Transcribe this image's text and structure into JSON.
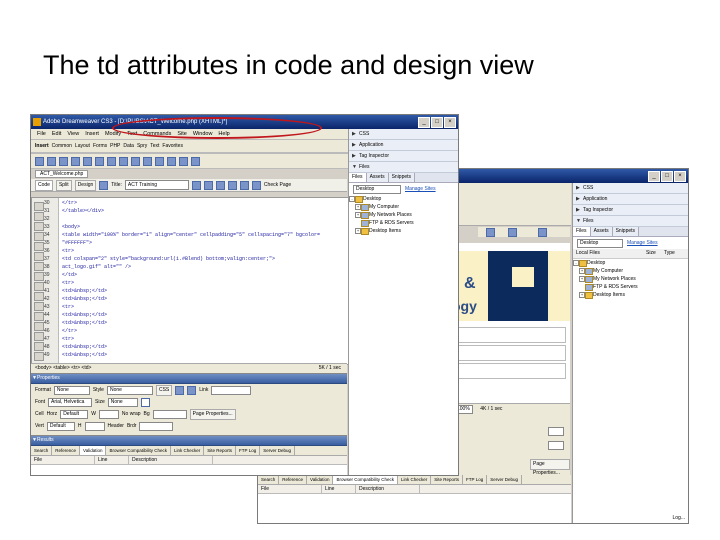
{
  "slide": {
    "title": "The td attributes in code and design view"
  },
  "front_window": {
    "title": "Adobe Dreamweaver CS3 - [D:\\PUBS\\ACT_Welcome.php (XHTML)*]",
    "window_buttons": [
      "_",
      "□",
      "×"
    ],
    "menu": [
      "File",
      "Edit",
      "View",
      "Insert",
      "Modify",
      "Text",
      "Commands",
      "Site",
      "Window",
      "Help"
    ],
    "insert_toolbar": [
      "Insert",
      "Common",
      "Layout",
      "Forms",
      "PHP",
      "Data",
      "Spry",
      "Text",
      "Favorites"
    ],
    "doc_tab": "ACT_Welcome.php",
    "view_buttons": [
      "Code",
      "Split",
      "Design"
    ],
    "title_label": "Title:",
    "title_value": "ACT Training",
    "check_page": "Check Page",
    "code_lines": [
      {
        "num": "30",
        "text": "</tr>"
      },
      {
        "num": "31",
        "text": "</table></div>"
      },
      {
        "num": "32",
        "text": ""
      },
      {
        "num": "33",
        "text": "<body>"
      },
      {
        "num": "34",
        "text": "<table width=\"100%\" border=\"1\" align=\"center\" cellpadding=\"5\" cellspacing=\"7\" bgcolor="
      },
      {
        "num": "35",
        "text": "\"#FFFFFF\">"
      },
      {
        "num": "36",
        "text": "<tr>"
      },
      {
        "num": "37",
        "text": "<td colspan=\"2\" style=\"background:url(i.#Blend) bottom;valign:center;\">"
      },
      {
        "num": "38",
        "text": "act_logo.gif\" alt=\"\" />"
      },
      {
        "num": "39",
        "text": "</td>"
      },
      {
        "num": "40",
        "text": "<tr>"
      },
      {
        "num": "41",
        "text": "<td>&nbsp;</td>"
      },
      {
        "num": "42",
        "text": "<td>&nbsp;</td>"
      },
      {
        "num": "43",
        "text": "<tr>"
      },
      {
        "num": "44",
        "text": "<td>&nbsp;</td>"
      },
      {
        "num": "45",
        "text": "<td>&nbsp;</td>"
      },
      {
        "num": "46",
        "text": "</tr>"
      },
      {
        "num": "47",
        "text": "<tr>"
      },
      {
        "num": "48",
        "text": "<td>&nbsp;</td>"
      },
      {
        "num": "49",
        "text": "<td>&nbsp;</td>"
      },
      {
        "num": "50",
        "text": "</tr>"
      }
    ],
    "tag_selector": "<body> <table> <tr> <td>",
    "size_readout": "5K / 1 sec",
    "properties": {
      "header": "Properties",
      "format_label": "Format",
      "format_value": "None",
      "style_label": "Style",
      "style_value": "None",
      "css_button": "CSS",
      "link_label": "Link",
      "font_label": "Font",
      "font_value": "Arial, Helvetica",
      "size_label": "Size",
      "size_value": "None",
      "cell_label": "Cell",
      "horz_label": "Horz",
      "horz_value": "Default",
      "vert_label": "Vert",
      "vert_value": "Default",
      "w_label": "W",
      "h_label": "H",
      "nowrap_label": "No wrap",
      "header_label": "Header",
      "bg_label": "Bg",
      "brdr_label": "Brdr",
      "page_properties": "Page Properties..."
    },
    "results": {
      "header": "Results",
      "tabs": [
        "Search",
        "Reference",
        "Validation",
        "Browser Compatibility Check",
        "Link Checker",
        "Site Reports",
        "FTP Log",
        "Server Debug"
      ],
      "columns": [
        "File",
        "Line",
        "Description"
      ]
    },
    "side_panels": [
      "CSS",
      "Application",
      "Tag Inspector",
      "Files"
    ],
    "files": {
      "tabs": [
        "Files",
        "Assets",
        "Snippets"
      ],
      "location": "Desktop",
      "manage_sites": "Manage Sites",
      "items": [
        "Desktop",
        "My Computer",
        "My Network Places",
        "FTP & RDS Servers",
        "Desktop Items"
      ]
    }
  },
  "back_window": {
    "side_panels": [
      "CSS",
      "Application",
      "Tag Inspector",
      "Files"
    ],
    "files_tabs": [
      "Files",
      "Assets",
      "Snippets"
    ],
    "location": "Desktop",
    "manage_sites": "Manage Sites",
    "local_files": "Local Files",
    "size_col": "Size",
    "type_col": "Type",
    "items": [
      "Desktop",
      "My Computer",
      "My Network Places",
      "FTP & RDS Servers",
      "Desktop Items"
    ],
    "logo_text_1": "&",
    "logo_text_2": "ogy",
    "zoom": "100%",
    "size_readout": "4K / 1 sec",
    "results_tabs": [
      "Search",
      "Reference",
      "Validation",
      "Browser Compatibility Check",
      "Link Checker",
      "Site Reports",
      "FTP Log",
      "Server Debug"
    ],
    "results_cols": [
      "File",
      "Line",
      "Description"
    ],
    "log_button": "Log..."
  }
}
